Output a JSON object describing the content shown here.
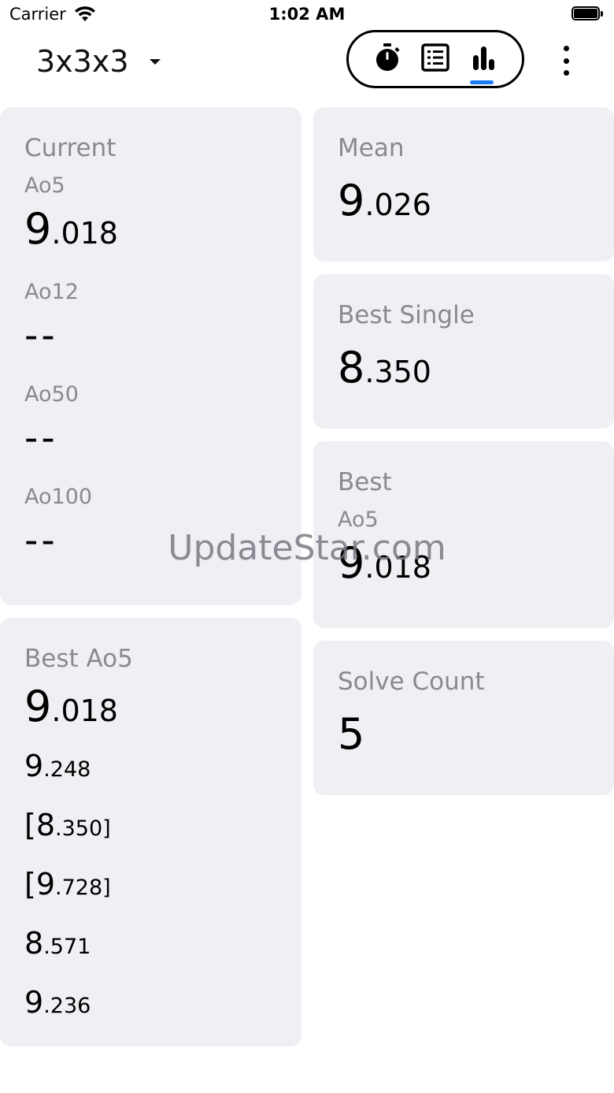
{
  "status_bar": {
    "carrier": "Carrier",
    "time": "1:02 AM"
  },
  "header": {
    "puzzle": "3x3x3",
    "modes": [
      {
        "name": "timer",
        "icon": "stopwatch-icon"
      },
      {
        "name": "list",
        "icon": "list-icon"
      },
      {
        "name": "stats",
        "icon": "bar-chart-icon",
        "active": true
      }
    ],
    "accent_color": "#1a7cf5"
  },
  "current": {
    "title": "Current",
    "ao5": {
      "label": "Ao5",
      "int": "9",
      "dec": ".018"
    },
    "ao12": {
      "label": "Ao12",
      "value": "--"
    },
    "ao50": {
      "label": "Ao50",
      "value": "--"
    },
    "ao100": {
      "label": "Ao100",
      "value": "--"
    }
  },
  "best_ao5": {
    "title": "Best Ao5",
    "value": {
      "int": "9",
      "dec": ".018"
    },
    "solves": [
      {
        "pre": "",
        "int": "9",
        "dec": ".248",
        "post": ""
      },
      {
        "pre": "[",
        "int": "8",
        "dec": ".350",
        "post": "]"
      },
      {
        "pre": "[",
        "int": "9",
        "dec": ".728",
        "post": "]"
      },
      {
        "pre": "",
        "int": "8",
        "dec": ".571",
        "post": ""
      },
      {
        "pre": "",
        "int": "9",
        "dec": ".236",
        "post": ""
      }
    ]
  },
  "mean": {
    "title": "Mean",
    "int": "9",
    "dec": ".026"
  },
  "best_single": {
    "title": "Best Single",
    "int": "8",
    "dec": ".350"
  },
  "best": {
    "title": "Best",
    "ao5": {
      "label": "Ao5",
      "int": "9",
      "dec": ".018"
    }
  },
  "solve_count": {
    "title": "Solve Count",
    "value": "5"
  },
  "watermark": "UpdateStar.com"
}
